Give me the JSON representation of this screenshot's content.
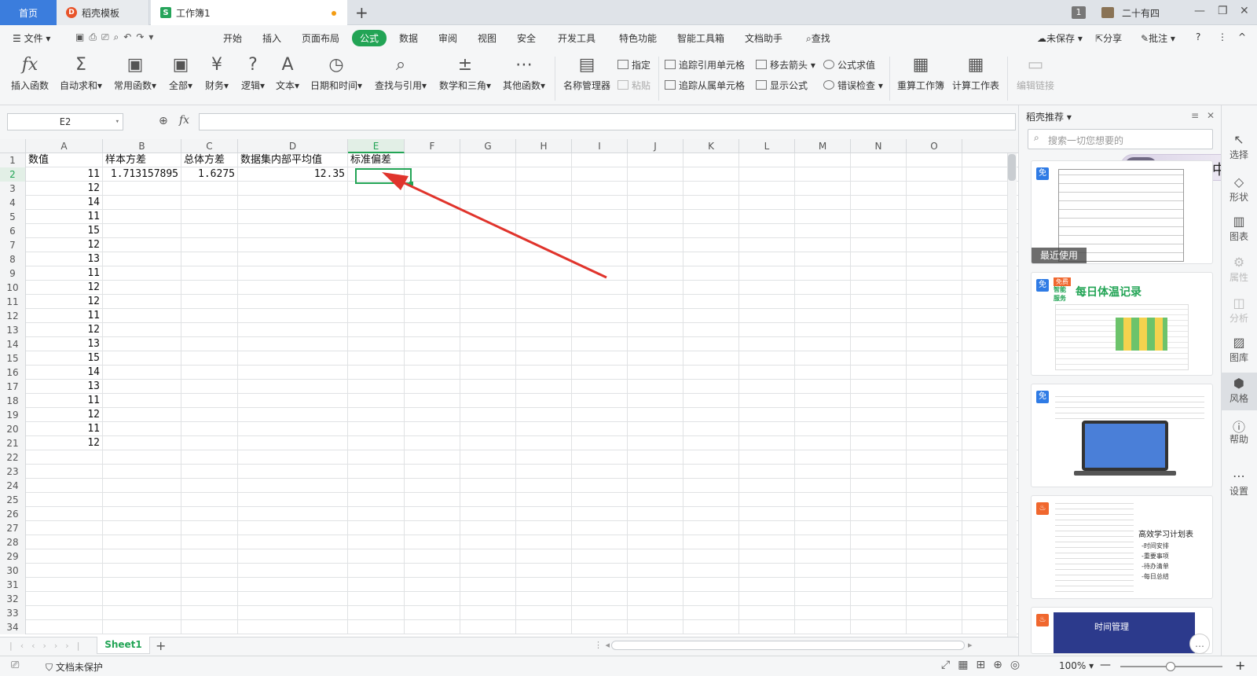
{
  "tabs": {
    "home": "首页",
    "template": "稻壳模板",
    "workbook": "工作簿1",
    "add": "+"
  },
  "titlebar": {
    "badge": "1",
    "user": "二十有四",
    "min": "—",
    "restore": "❐",
    "close": "✕"
  },
  "menu": {
    "file": "文件",
    "items": [
      "开始",
      "插入",
      "页面布局",
      "公式",
      "数据",
      "审阅",
      "视图",
      "安全",
      "开发工具",
      "特色功能",
      "智能工具箱",
      "文档助手"
    ],
    "search": "查找",
    "right": {
      "unsaved": "未保存",
      "share": "分享",
      "comment": "批注",
      "help": "?",
      "more": "⋮",
      "collapse": "^"
    }
  },
  "ribbon": {
    "insert_fn": "插入函数",
    "autosum": "自动求和",
    "common": "常用函数",
    "all": "全部",
    "finance": "财务",
    "logic": "逻辑",
    "text": "文本",
    "datetime": "日期和时间",
    "lookup": "查找与引用",
    "math": "数学和三角",
    "other": "其他函数",
    "name_mgr": "名称管理器",
    "specify": "指定",
    "paste": "粘贴",
    "trace_prec": "追踪引用单元格",
    "trace_dep": "追踪从属单元格",
    "remove_arrows": "移去箭头",
    "show_formula": "显示公式",
    "eval": "公式求值",
    "error_check": "错误检查",
    "recalc_wb": "重算工作簿",
    "recalc_ws": "计算工作表",
    "edit_links": "编辑链接"
  },
  "formula_bar": {
    "name_box": "E2",
    "fx": "fx",
    "value": ""
  },
  "columns": [
    "A",
    "B",
    "C",
    "D",
    "E",
    "F",
    "G",
    "H",
    "I",
    "J",
    "K",
    "L",
    "M",
    "N",
    "O"
  ],
  "rows": [
    {
      "n": "1",
      "A": "数值",
      "B": "样本方差",
      "C": "总体方差",
      "D": "数据集内部平均值",
      "E": "标准偏差"
    },
    {
      "n": "2",
      "A": "11",
      "B": "1.713157895",
      "C": "1.6275",
      "D": "12.35",
      "E": ""
    },
    {
      "n": "3",
      "A": "12"
    },
    {
      "n": "4",
      "A": "14"
    },
    {
      "n": "5",
      "A": "11"
    },
    {
      "n": "6",
      "A": "15"
    },
    {
      "n": "7",
      "A": "12"
    },
    {
      "n": "8",
      "A": "13"
    },
    {
      "n": "9",
      "A": "11"
    },
    {
      "n": "10",
      "A": "12"
    },
    {
      "n": "11",
      "A": "12"
    },
    {
      "n": "12",
      "A": "11"
    },
    {
      "n": "13",
      "A": "12"
    },
    {
      "n": "14",
      "A": "13"
    },
    {
      "n": "15",
      "A": "15"
    },
    {
      "n": "16",
      "A": "14"
    },
    {
      "n": "17",
      "A": "13"
    },
    {
      "n": "18",
      "A": "11"
    },
    {
      "n": "19",
      "A": "12"
    },
    {
      "n": "20",
      "A": "11"
    },
    {
      "n": "21",
      "A": "12"
    },
    {
      "n": "22"
    },
    {
      "n": "23"
    },
    {
      "n": "24"
    },
    {
      "n": "25"
    },
    {
      "n": "26"
    },
    {
      "n": "27"
    },
    {
      "n": "28"
    },
    {
      "n": "29"
    },
    {
      "n": "30"
    },
    {
      "n": "31"
    },
    {
      "n": "32"
    },
    {
      "n": "33"
    },
    {
      "n": "34"
    }
  ],
  "sheet": {
    "name": "Sheet1",
    "add": "+"
  },
  "status": {
    "protect": "文档未保护",
    "zoom": "100%",
    "minus": "—",
    "plus": "+"
  },
  "panel": {
    "title": "稻壳推荐",
    "search_placeholder": "搜索一切您想要的",
    "ime": "中",
    "recent": "最近使用",
    "free": "免",
    "card2_tag": "免费",
    "card2_title": "每日体温记录",
    "card2_sub": "智能\n服务",
    "card4_title": "高效学习计划表",
    "card4_items": [
      "-时间安排",
      "-重要事项",
      "-待办清单",
      "-每日总结"
    ],
    "card5_title": "时间管理"
  },
  "rail": [
    "选择",
    "形状",
    "图表",
    "属性",
    "分析",
    "图库",
    "风格",
    "帮助",
    "设置"
  ],
  "colors": {
    "accent": "#22a455",
    "home_tab": "#3b7ddd",
    "arrow": "#e0342c"
  }
}
